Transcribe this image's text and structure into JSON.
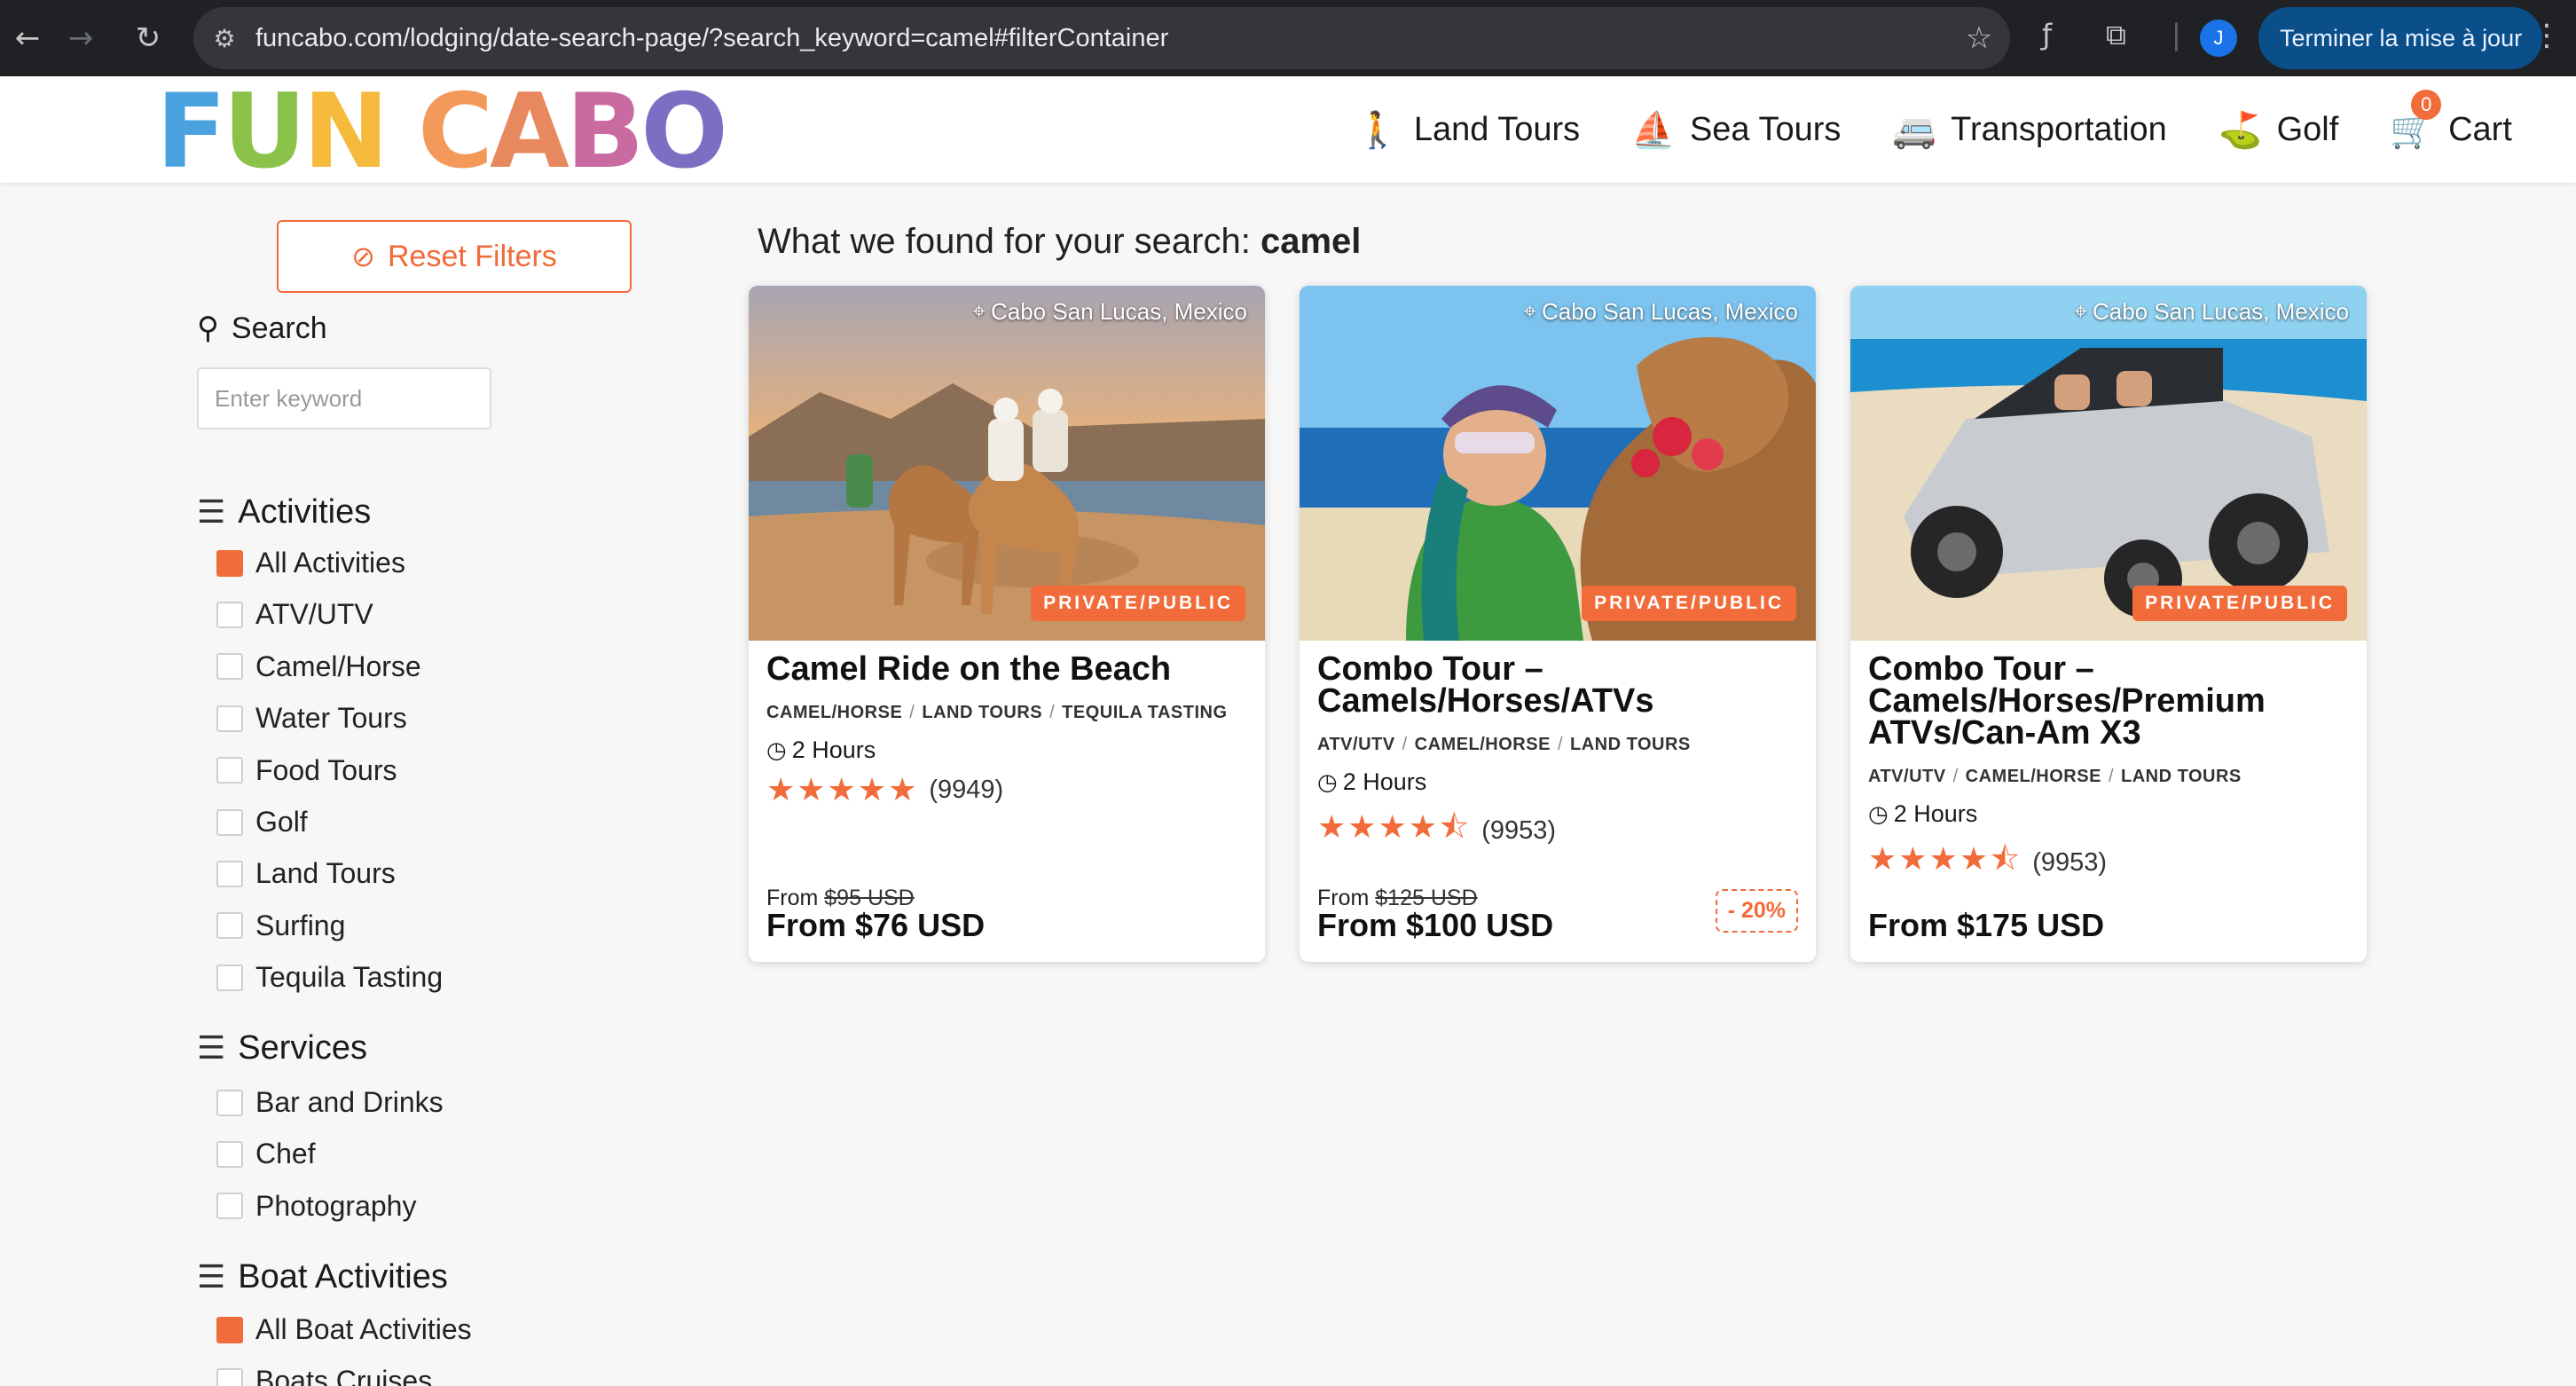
{
  "browser": {
    "url": "funcabo.com/lodging/date-search-page/?search_keyword=camel#filterContainer",
    "profile_initial": "J",
    "update_label": "Terminer la mise à jour"
  },
  "site": {
    "logo_letters": [
      "F",
      "U",
      "N",
      " ",
      "C",
      "A",
      "B",
      "O"
    ],
    "logo_colors": [
      "#4aa3df",
      "#8bc34a",
      "#f5b93b",
      "#ffffff",
      "#f39a5b",
      "#e8885e",
      "#c96aa0",
      "#7b6fc4"
    ],
    "nav": [
      {
        "label": "Land Tours",
        "icon": "hiking-icon"
      },
      {
        "label": "Sea Tours",
        "icon": "sailboat-icon"
      },
      {
        "label": "Transportation",
        "icon": "shuttle-icon"
      },
      {
        "label": "Golf",
        "icon": "golf-icon"
      }
    ],
    "cart_label": "Cart",
    "cart_count": "0"
  },
  "sidebar": {
    "reset_label": "Reset Filters",
    "search_heading": "Search",
    "search_placeholder": "Enter keyword",
    "activities_heading": "Activities",
    "activities": [
      {
        "label": "All Activities",
        "checked": true
      },
      {
        "label": "ATV/UTV",
        "checked": false
      },
      {
        "label": "Camel/Horse",
        "checked": false
      },
      {
        "label": "Water Tours",
        "checked": false
      },
      {
        "label": "Food Tours",
        "checked": false
      },
      {
        "label": "Golf",
        "checked": false
      },
      {
        "label": "Land Tours",
        "checked": false
      },
      {
        "label": "Surfing",
        "checked": false
      },
      {
        "label": "Tequila Tasting",
        "checked": false
      }
    ],
    "services_heading": "Services",
    "services": [
      {
        "label": "Bar and Drinks",
        "checked": false
      },
      {
        "label": "Chef",
        "checked": false
      },
      {
        "label": "Photography",
        "checked": false
      }
    ],
    "boat_heading": "Boat Activities",
    "boat": [
      {
        "label": "All Boat Activities",
        "checked": true
      },
      {
        "label": "Boats Cruises",
        "checked": false
      }
    ]
  },
  "results": {
    "prefix": "What we found for your search:",
    "keyword": "camel",
    "cards": [
      {
        "location": "Cabo San Lucas, Mexico",
        "badge": "PRIVATE/PUBLIC",
        "title": "Camel Ride on the Beach",
        "categories": [
          "CAMEL/HORSE",
          "LAND TOURS",
          "TEQUILA TASTING"
        ],
        "duration": "2 Hours",
        "rating_stars": 5,
        "reviews": "(9949)",
        "from_label": "From",
        "old_price": "$95 USD",
        "price": "From $76 USD",
        "discount": ""
      },
      {
        "location": "Cabo San Lucas, Mexico",
        "badge": "PRIVATE/PUBLIC",
        "title": "Combo Tour – Camels/Horses/ATVs",
        "categories": [
          "ATV/UTV",
          "CAMEL/HORSE",
          "LAND TOURS"
        ],
        "duration": "2 Hours",
        "rating_stars": 4.5,
        "reviews": "(9953)",
        "from_label": "From",
        "old_price": "$125 USD",
        "price": "From $100 USD",
        "discount": "- 20%"
      },
      {
        "location": "Cabo San Lucas, Mexico",
        "badge": "PRIVATE/PUBLIC",
        "title": "Combo Tour – Camels/Horses/Premium ATVs/Can-Am X3",
        "categories": [
          "ATV/UTV",
          "CAMEL/HORSE",
          "LAND TOURS"
        ],
        "duration": "2 Hours",
        "rating_stars": 4.5,
        "reviews": "(9953)",
        "from_label": "",
        "old_price": "",
        "price": "From $175 USD",
        "discount": ""
      }
    ]
  }
}
